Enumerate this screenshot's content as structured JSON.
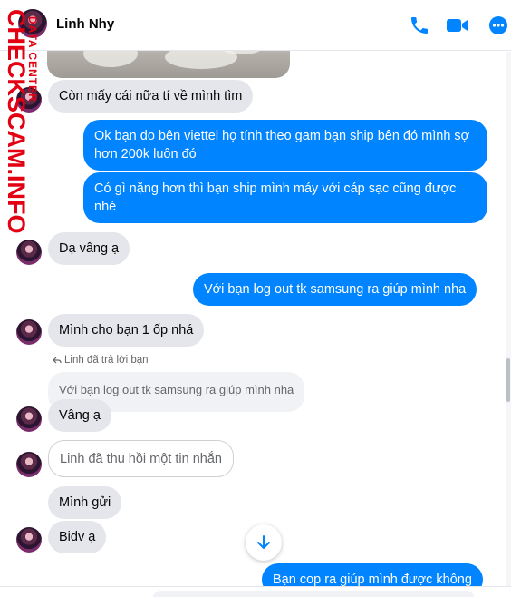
{
  "header": {
    "contact_name": "Linh Nhy",
    "icons": [
      "phone-icon",
      "video-icon",
      "more-icon"
    ],
    "accent_color": "#0084ff"
  },
  "watermark": {
    "main": "CHECKSCAM.INFO",
    "sub": "DATA CENTER"
  },
  "messages": {
    "m1": "Còn mấy cái nữa tí về mình tìm",
    "m2": "Ok bạn do bên viettel họ tính theo gam bạn ship bên đó mình sợ hơn 200k luôn đó",
    "m3": "Có gì nặng hơn thì bạn ship mình máy với cáp sạc cũng được nhé",
    "m4": "Dạ vâng ạ",
    "m5": "Với bạn log out tk samsung ra giúp mình nha",
    "m6": "Mình cho bạn 1 ốp nhá",
    "reply_label": "Linh đã trả lời bạn",
    "quoted": "Với bạn log out tk samsung ra giúp mình nha",
    "m7": "Vâng ạ",
    "recalled": "Linh đã thu hồi một tin nhắn",
    "m8": "Mình gửi",
    "m9": "Bidv ạ",
    "m10": "Bạn cop ra giúp mình được không"
  }
}
